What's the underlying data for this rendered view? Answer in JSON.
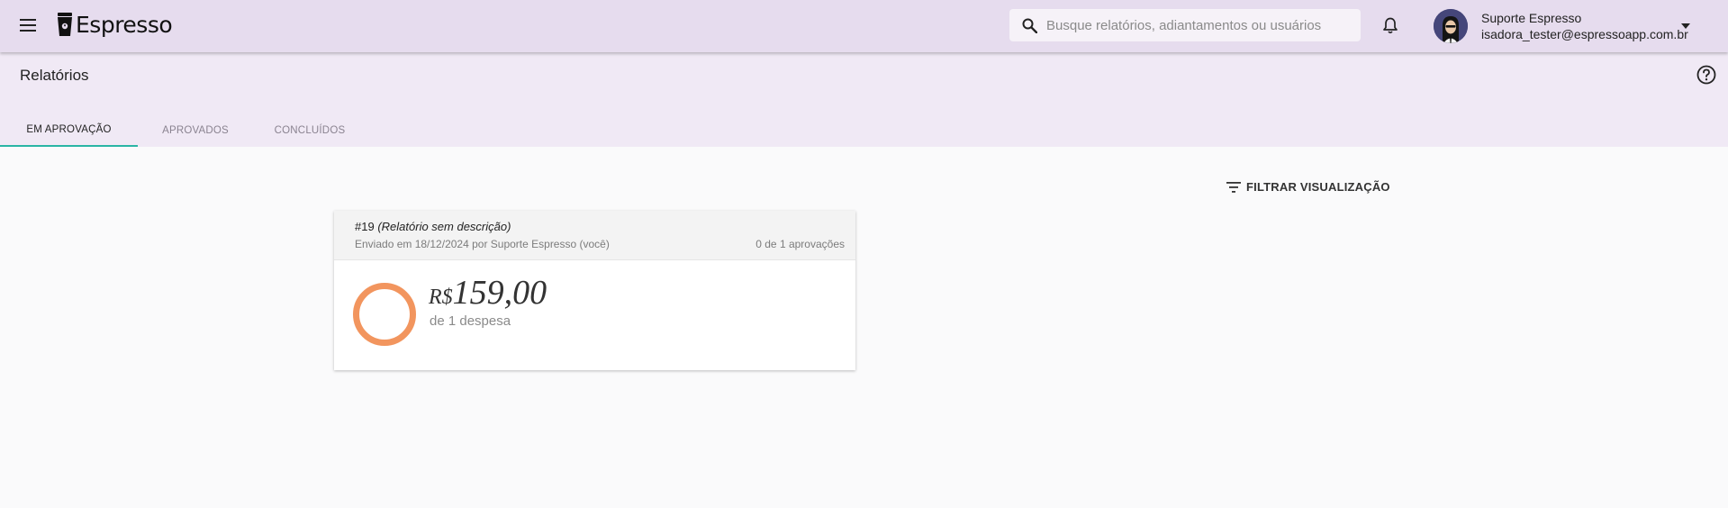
{
  "app": {
    "name": "Espresso"
  },
  "search": {
    "placeholder": "Busque relatórios, adiantamentos ou usuários"
  },
  "user": {
    "name": "Suporte Espresso",
    "email": "isadora_tester@espressoapp.com.br"
  },
  "page": {
    "title": "Relatórios"
  },
  "tabs": [
    {
      "label": "EM APROVAÇÃO",
      "active": true
    },
    {
      "label": "APROVADOS",
      "active": false
    },
    {
      "label": "CONCLUÍDOS",
      "active": false
    }
  ],
  "filter": {
    "label": "FILTRAR VISUALIZAÇÃO"
  },
  "reports": [
    {
      "number": "#19",
      "description": "(Relatório sem descrição)",
      "submitted": "Enviado em 18/12/2024 por Suporte Espresso (você)",
      "approvals": "0 de 1 aprovações",
      "currency": "R$",
      "amount": "159,00",
      "expenses": "de 1 despesa"
    }
  ],
  "colors": {
    "appbar": "#e6dcee",
    "header": "#f0e9f5",
    "tab_indicator": "#2ab5a5",
    "status_ring": "#f2955e"
  },
  "icons": [
    "menu-icon",
    "cup-icon",
    "search-icon",
    "bell-icon",
    "caret-down-icon",
    "help-icon",
    "filter-icon"
  ]
}
